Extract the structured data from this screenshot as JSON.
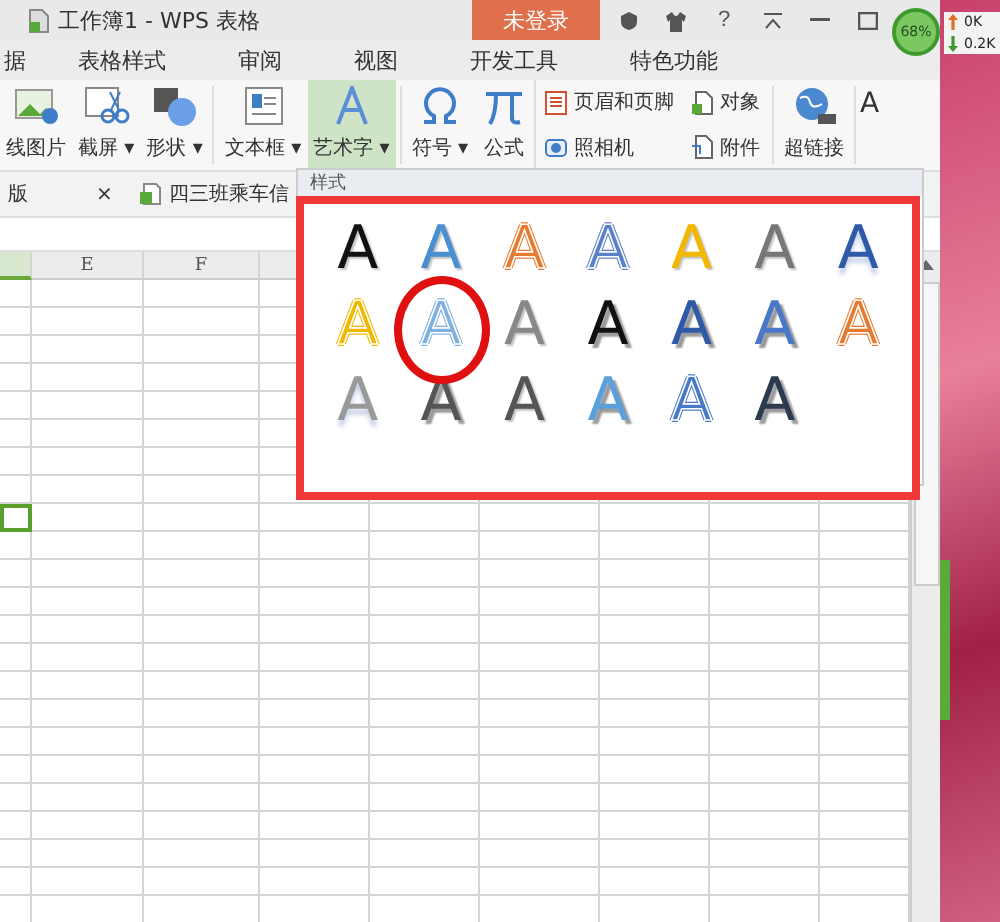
{
  "window": {
    "title": "工作簿1 - WPS 表格",
    "login_button": "未登录",
    "help": "?"
  },
  "menu": [
    {
      "label": "据",
      "selected": false
    },
    {
      "label": "表格样式",
      "selected": false
    },
    {
      "label": "审阅",
      "selected": false
    },
    {
      "label": "视图",
      "selected": false
    },
    {
      "label": "开发工具",
      "selected": false
    },
    {
      "label": "特色功能",
      "selected": false
    }
  ],
  "ribbon": {
    "large": [
      {
        "label": "线图片",
        "selected": false
      },
      {
        "label": "截屏",
        "caret": "▾",
        "selected": false
      },
      {
        "label": "形状",
        "caret": "▾",
        "selected": false
      },
      {
        "label": "文本框",
        "caret": "▾",
        "selected": false
      },
      {
        "label": "艺术字",
        "caret": "▾",
        "selected": true
      },
      {
        "label": "符号",
        "caret": "▾",
        "selected": false
      },
      {
        "label": "公式",
        "selected": false
      }
    ],
    "small": [
      {
        "label": "页眉和页脚"
      },
      {
        "label": "对象"
      },
      {
        "label": "照相机"
      },
      {
        "label": "附件"
      }
    ],
    "link": {
      "label": "超链接"
    },
    "tail_glyph": "A"
  },
  "doc_tabs": [
    {
      "label": "版",
      "close": "×"
    },
    {
      "label": "四三班乘车信"
    }
  ],
  "wordart_panel": {
    "header": "样式",
    "styles": [
      {
        "glyph": "A",
        "kind": "solid",
        "color": "#111111",
        "circled": false
      },
      {
        "glyph": "A",
        "kind": "solid",
        "color": "#4a90d0",
        "circled": false
      },
      {
        "glyph": "A",
        "kind": "outline",
        "color": "#e87a30",
        "circled": false
      },
      {
        "glyph": "A",
        "kind": "outline",
        "color": "#5b7fc8",
        "circled": false
      },
      {
        "glyph": "A",
        "kind": "solid",
        "color": "#f2b800",
        "circled": false
      },
      {
        "glyph": "A",
        "kind": "solid",
        "color": "#777777",
        "circled": false
      },
      {
        "glyph": "A",
        "kind": "reflected",
        "color": "#2e5aa8",
        "circled": false
      },
      {
        "glyph": "A",
        "kind": "outline",
        "color": "#f2b800",
        "circled": false
      },
      {
        "glyph": "A",
        "kind": "outline",
        "color": "#7fb0e0",
        "circled": true
      },
      {
        "glyph": "A",
        "kind": "solid",
        "color": "#888888",
        "circled": false
      },
      {
        "glyph": "A",
        "kind": "shadowed",
        "color": "#111111",
        "circled": false
      },
      {
        "glyph": "A",
        "kind": "shadowed",
        "color": "#2e5aa8",
        "circled": false
      },
      {
        "glyph": "A",
        "kind": "shadowed",
        "color": "#4a78c8",
        "circled": false
      },
      {
        "glyph": "A",
        "kind": "outline",
        "color": "#e87a30",
        "circled": false
      },
      {
        "glyph": "A",
        "kind": "reflected",
        "color": "#999999",
        "circled": false
      },
      {
        "glyph": "A",
        "kind": "shadowed",
        "color": "#555555",
        "circled": false
      },
      {
        "glyph": "A",
        "kind": "solid",
        "color": "#555555",
        "circled": false
      },
      {
        "glyph": "A",
        "kind": "shadowed",
        "color": "#5aa0dc",
        "circled": false
      },
      {
        "glyph": "A",
        "kind": "outline",
        "color": "#4a78c8",
        "circled": false
      },
      {
        "glyph": "A",
        "kind": "shadowed",
        "color": "#2c3a50",
        "circled": false
      }
    ]
  },
  "network_widget": {
    "percent": "68%",
    "upload": "0K",
    "download": "0.2K"
  },
  "sheet": {
    "columns": [
      "",
      "E",
      "F",
      "",
      "",
      "",
      "",
      "",
      ""
    ],
    "rows": [
      {
        "selected": false
      },
      {
        "selected": false
      },
      {
        "selected": false
      },
      {
        "selected": false
      },
      {
        "selected": false
      },
      {
        "selected": false
      },
      {
        "selected": false
      },
      {
        "selected": false
      },
      {
        "selected": true
      },
      {
        "selected": false
      },
      {
        "selected": false
      },
      {
        "selected": false
      },
      {
        "selected": false
      },
      {
        "selected": false
      },
      {
        "selected": false
      },
      {
        "selected": false
      },
      {
        "selected": false
      },
      {
        "selected": false
      },
      {
        "selected": false
      },
      {
        "selected": false
      },
      {
        "selected": false
      },
      {
        "selected": false
      },
      {
        "selected": false
      }
    ]
  }
}
